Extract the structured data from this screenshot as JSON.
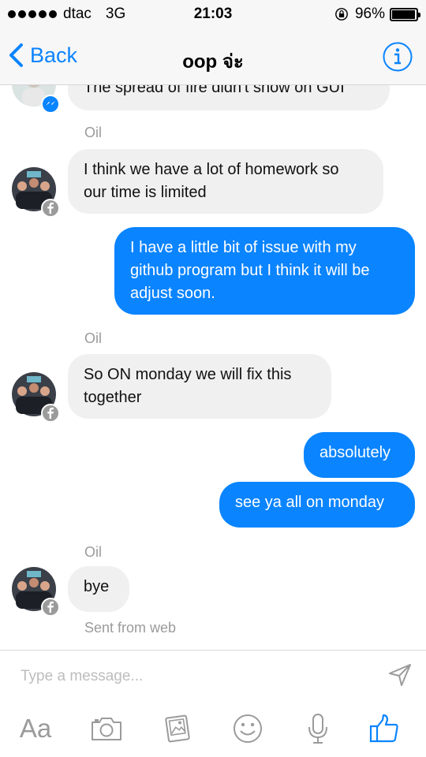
{
  "status_bar": {
    "carrier": "dtac",
    "network": "3G",
    "time": "21:03",
    "battery": "96%",
    "battery_level": 0.96
  },
  "nav": {
    "back_label": "Back",
    "title": "oop จ่ะ"
  },
  "messages": {
    "partial_top": "The spread of fire didn't show on GUI",
    "m1": {
      "sender": "Oil",
      "text_line1": "I think we have a lot of homework so",
      "text_line2": "our time is limited"
    },
    "m2": {
      "text_line1": "I have a little bit of issue with my",
      "text_line2": "github program but I think it will be",
      "text_line3": "adjust soon."
    },
    "m3": {
      "sender": "Oil",
      "text_line1": "So ON monday we will fix this",
      "text_line2": "together"
    },
    "m4": {
      "text": "absolutely"
    },
    "m5": {
      "text": "see ya all on monday"
    },
    "m6": {
      "sender": "Oil",
      "text": "bye",
      "meta": "Sent from web"
    }
  },
  "composer": {
    "placeholder": "Type a message...",
    "text_button": "Aa"
  },
  "colors": {
    "accent": "#0a84ff",
    "incoming_bubble": "#f1f0f0",
    "muted_text": "#9b9b9b",
    "bar_bg": "#f7f7f7"
  },
  "icons": [
    "back-chevron-icon",
    "info-icon",
    "messenger-badge-icon",
    "facebook-badge-icon",
    "send-icon",
    "camera-icon",
    "photo-icon",
    "emoji-icon",
    "microphone-icon",
    "like-icon",
    "lock-rotation-icon",
    "battery-icon"
  ]
}
